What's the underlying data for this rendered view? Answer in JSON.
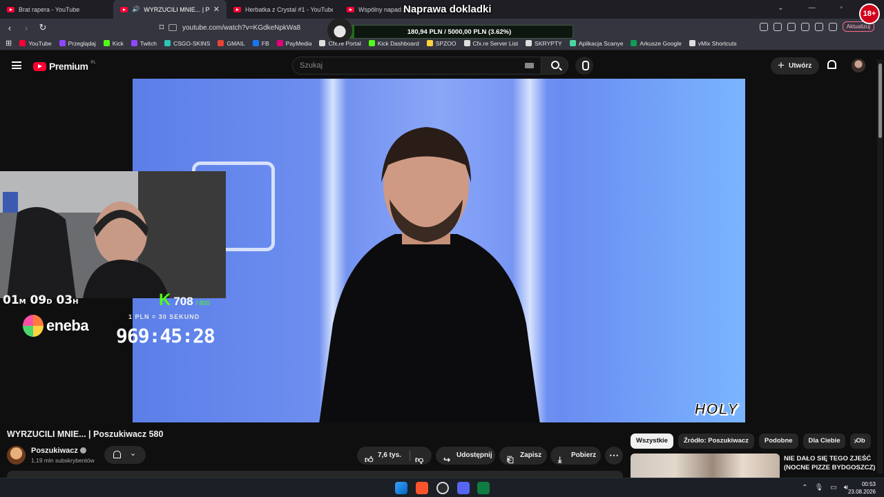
{
  "browser": {
    "tabs": [
      {
        "title": "Brat rapera - YouTube",
        "active": false
      },
      {
        "title": "WYRZUCILI MNIE... | Poszukiw",
        "active": true
      },
      {
        "title": "Herbatka z Crystal #1 - YouTube",
        "active": false
      },
      {
        "title": "Wspólny napad z C",
        "active": false
      }
    ],
    "url": "youtube.com/watch?v=KGdkeNpkWa8",
    "update_label": "Aktualizuj",
    "bookmarks": [
      {
        "label": "YouTube",
        "color": "#ff0033"
      },
      {
        "label": "Przeglądaj",
        "color": "#9146ff"
      },
      {
        "label": "Kick",
        "color": "#53fc18"
      },
      {
        "label": "Twitch",
        "color": "#9146ff"
      },
      {
        "label": "CSGO-SKINS",
        "color": "#2ec4b6"
      },
      {
        "label": "GMAIL",
        "color": "#ea4335"
      },
      {
        "label": "FB",
        "color": "#1877f2"
      },
      {
        "label": "PayMedia",
        "color": "#e6007e"
      },
      {
        "label": "Cfx.re Portal",
        "color": "#dddddd"
      },
      {
        "label": "Kick Dashboard",
        "color": "#53fc18"
      },
      {
        "label": "SPZOO",
        "color": "#ffd23f"
      },
      {
        "label": "Cfx.re Server List",
        "color": "#dddddd"
      },
      {
        "label": "SKRYPTY",
        "color": "#dddddd"
      },
      {
        "label": "Aplikacja Scanye",
        "color": "#4ad6a0"
      },
      {
        "label": "Arkusze Google",
        "color": "#0f9d58"
      },
      {
        "label": "vMix Shortcuts",
        "color": "#dddddd"
      }
    ]
  },
  "youtube": {
    "logo_text": "Premium",
    "logo_region": "PL",
    "search_placeholder": "Szukaj",
    "create_label": "Utwórz"
  },
  "overlay": {
    "goal_title": "Naprawa dokladki",
    "goal_text": "180,94 PLN / 5000,00 PLN  (3.62%)",
    "goal_percent": 3.62,
    "badge": "18+",
    "subathon_days": "01",
    "subathon_days_unit": "M",
    "subathon_hours": "09",
    "subathon_hours_unit": "D",
    "subathon_mins": "03",
    "subathon_mins_unit": "H",
    "sponsor": "eneba",
    "kick_logo": "K",
    "kick_count": "708",
    "kick_max": "/ 800",
    "rate_text": "1 PLN = 30 SEKUND",
    "timer": "969:45:28",
    "watermark": "HOLY"
  },
  "video": {
    "title": "WYRZUCILI MNIE... | Poszukiwacz 580",
    "channel": "Poszukiwacz",
    "subscribers": "1,19 mln subskrybentów",
    "likes": "7,6 tys.",
    "share_label": "Udostępnij",
    "save_label": "Zapisz",
    "download_label": "Pobierz"
  },
  "sidebar": {
    "chips": [
      "Wszystkie",
      "Źródło: Poszukiwacz",
      "Podobne",
      "Dla Ciebie",
      "Ob"
    ],
    "rec_title": "NIE DAŁO SIĘ TEGO ZJEŚĆ (NOCNE PIZZE BYDGOSZCZ)"
  },
  "taskbar": {
    "time": "00:53",
    "date": "23.08.2026"
  }
}
